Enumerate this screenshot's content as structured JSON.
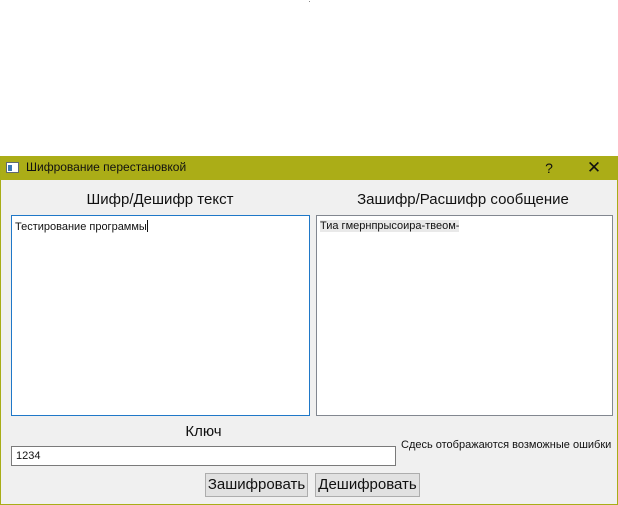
{
  "window": {
    "title": "Шифрование перестановкой",
    "help_label": "?",
    "close_label": "✕"
  },
  "input_panel": {
    "heading": "Шифр/Дешифр текст",
    "text": "Тестирование программы"
  },
  "output_panel": {
    "heading": "Зашифр/Расшифр сообщение",
    "text": "Тиа гмернпрысоира-твеом-"
  },
  "key": {
    "label": "Ключ",
    "value": "1234"
  },
  "error_message": "Сдесь отображаются возможные ошибки",
  "buttons": {
    "encrypt": "Зашифровать",
    "decrypt": "Дешифровать"
  },
  "colors": {
    "titlebar": "#abad17",
    "focus_border": "#1f78c8"
  }
}
